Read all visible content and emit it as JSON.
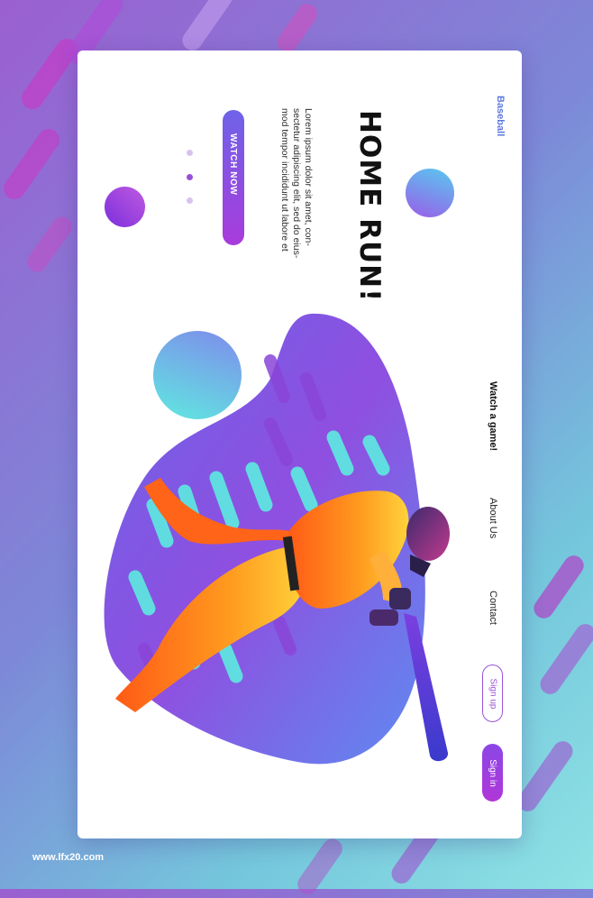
{
  "brand": "Baseball",
  "hero": {
    "headline": "HOME RUN!",
    "body": "Lorem ipsum dolor sit amet, con-sectetur adipiscing elit, sed do eius-mod tempor incididunt ut labore et",
    "cta_label": "WATCH NOW"
  },
  "nav": {
    "items": [
      {
        "label": "Watch a game!"
      },
      {
        "label": "About Us"
      },
      {
        "label": "Contact"
      }
    ],
    "signup_label": "Sign up",
    "signin_label": "Sign in"
  },
  "footer": {
    "watermark": "www.lfx20.com"
  },
  "colors": {
    "accent_purple": "#9a45de",
    "accent_blue": "#5b78e0",
    "accent_cyan": "#5fe4e0",
    "player_orange": "#ff8a1c"
  },
  "icons": [
    "play-triangle-icon"
  ]
}
